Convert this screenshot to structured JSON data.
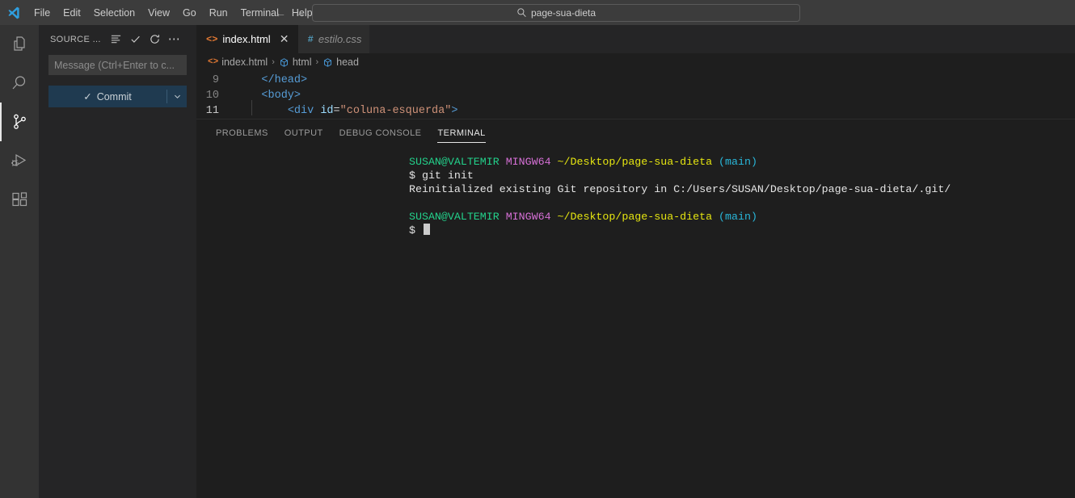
{
  "titlebar": {
    "logo_name": "vscode-logo-icon",
    "menus": [
      "File",
      "Edit",
      "Selection",
      "View",
      "Go",
      "Run",
      "Terminal",
      "Help"
    ],
    "nav_back": "←",
    "nav_forward": "→",
    "quick_open_value": "page-sua-dieta",
    "search_icon": "search-icon"
  },
  "activitybar": {
    "items": [
      {
        "name": "explorer",
        "icon": "files-icon",
        "active": false
      },
      {
        "name": "search",
        "icon": "search-icon",
        "active": false
      },
      {
        "name": "source-control",
        "icon": "source-control-icon",
        "active": true
      },
      {
        "name": "run-debug",
        "icon": "run-and-debug-icon",
        "active": false
      },
      {
        "name": "extensions",
        "icon": "extensions-icon",
        "active": false
      }
    ]
  },
  "sidebar": {
    "title": "SOURCE ...",
    "actions": [
      {
        "name": "view-as-list",
        "icon": "list-icon"
      },
      {
        "name": "commit",
        "icon": "check-icon"
      },
      {
        "name": "refresh",
        "icon": "refresh-icon"
      },
      {
        "name": "more-actions",
        "icon": "ellipsis-icon"
      }
    ],
    "message_placeholder": "Message (Ctrl+Enter to c...",
    "commit_label": "Commit",
    "commit_check": "✓",
    "commit_dropdown_icon": "chevron-down-icon",
    "commit_color": "#1f3a50"
  },
  "editor": {
    "tabs": [
      {
        "label": "index.html",
        "icon": "html-file-icon",
        "icon_glyph": "<>",
        "active": true,
        "italic": false,
        "closable": true
      },
      {
        "label": "estilo.css",
        "icon": "css-file-icon",
        "icon_glyph": "#",
        "active": false,
        "italic": true,
        "closable": false
      }
    ],
    "close_glyph": "✕",
    "breadcrumb": [
      {
        "label": "index.html",
        "icon": "html-file-icon",
        "glyph": "<>"
      },
      {
        "label": "html",
        "icon": "symbol-module-icon",
        "glyph": ""
      },
      {
        "label": "head",
        "icon": "symbol-module-icon",
        "glyph": ""
      }
    ],
    "breadcrumb_separator": "›",
    "code_lines": [
      {
        "number": "9",
        "current": false,
        "tokens": [
          {
            "t": "    ",
            "c": "t-eq"
          },
          {
            "t": "</head>",
            "c": "t-tag"
          }
        ]
      },
      {
        "number": "10",
        "current": false,
        "tokens": [
          {
            "t": "    ",
            "c": "t-eq"
          },
          {
            "t": "<body>",
            "c": "t-tag"
          }
        ]
      },
      {
        "number": "11",
        "current": true,
        "tokens": [
          {
            "t": "        <",
            "c": "t-tag"
          },
          {
            "t": "div",
            "c": "t-tag"
          },
          {
            "t": " ",
            "c": "t-eq"
          },
          {
            "t": "id",
            "c": "t-attr"
          },
          {
            "t": "=",
            "c": "t-eq"
          },
          {
            "t": "\"coluna-esquerda\"",
            "c": "t-str"
          },
          {
            "t": ">",
            "c": "t-tag"
          }
        ]
      }
    ]
  },
  "panel": {
    "tabs": [
      "PROBLEMS",
      "OUTPUT",
      "DEBUG CONSOLE",
      "TERMINAL"
    ],
    "active_tab": "TERMINAL",
    "terminal_lines": [
      {
        "type": "prompt",
        "user": "SUSAN@VALTEMIR",
        "shell": "MINGW64",
        "path": "~/Desktop/page-sua-dieta",
        "branch": "(main)"
      },
      {
        "type": "command",
        "text": "$ git init"
      },
      {
        "type": "output",
        "text": "Reinitialized existing Git repository in C:/Users/SUSAN/Desktop/page-sua-dieta/.git/"
      },
      {
        "type": "blank"
      },
      {
        "type": "prompt",
        "user": "SUSAN@VALTEMIR",
        "shell": "MINGW64",
        "path": "~/Desktop/page-sua-dieta",
        "branch": "(main)"
      },
      {
        "type": "input",
        "text": "$ ",
        "cursor": true
      }
    ],
    "colors": {
      "user": "#23d18b",
      "shell": "#d670d6",
      "path": "#e5e510",
      "branch": "#29b8db",
      "text": "#e5e5e5"
    }
  }
}
